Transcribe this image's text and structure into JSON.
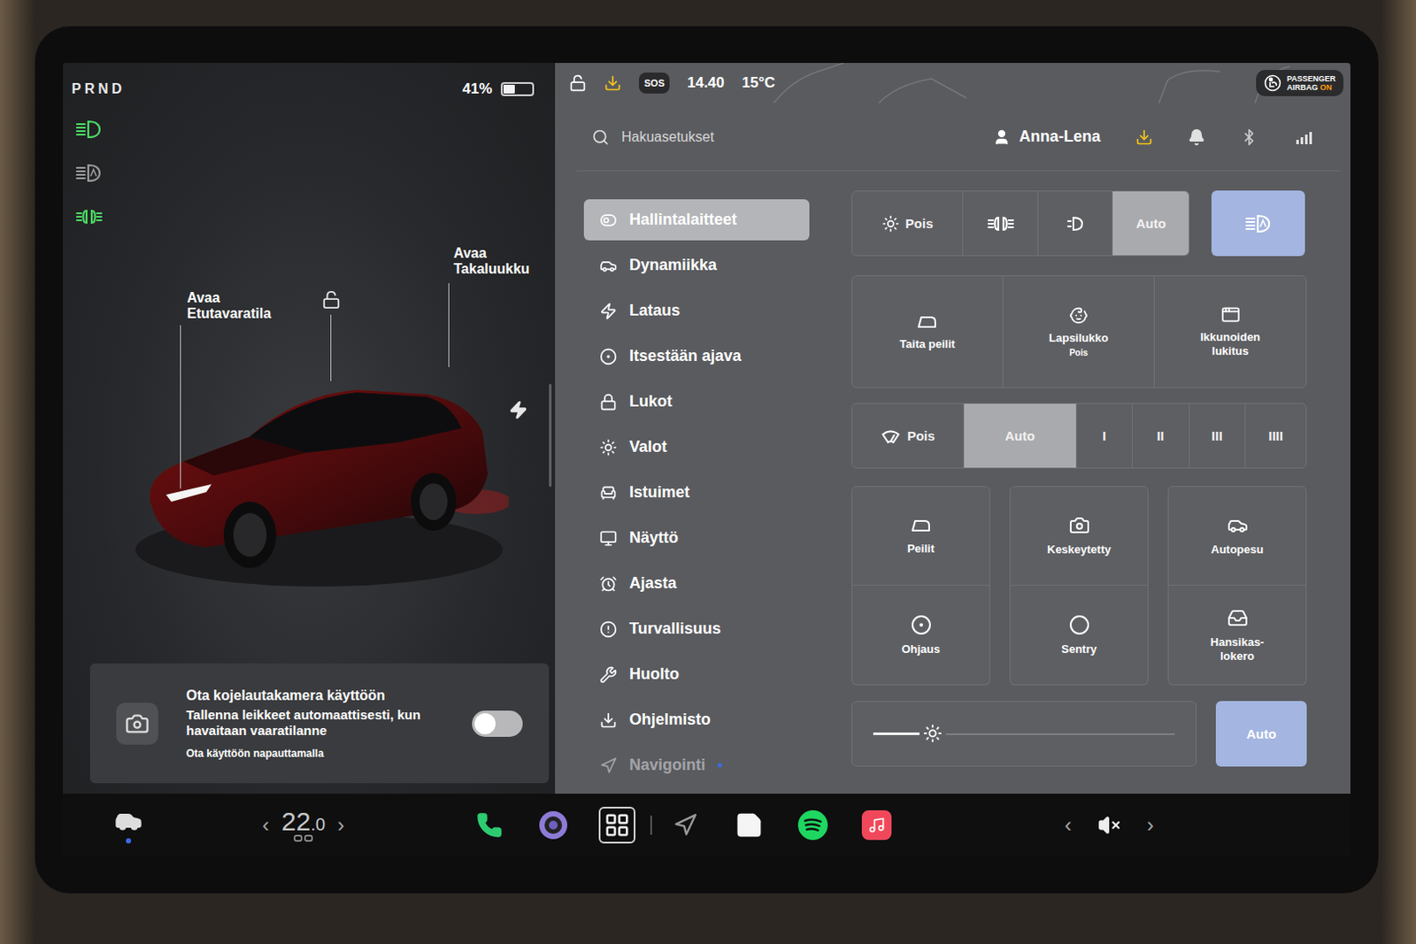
{
  "left_panel": {
    "gear": "PRND",
    "battery": {
      "text": "41%",
      "level": 0.41
    },
    "indicators": [
      {
        "on": true
      },
      {
        "on": false
      },
      {
        "on": true
      }
    ],
    "car_labels": [
      "Avaa\nEtutavaratila",
      "Avaa\nTakaluukku"
    ],
    "unlocked": true
  },
  "dashcam_card": {
    "title": "Ota kojelautakamera käyttöön",
    "description": "Tallenna leikkeet automaattisesti, kun havaitaan vaaratilanne",
    "hint": "Ota käyttöön napauttamalla",
    "on": false
  },
  "status_bar": {
    "sos": "SOS",
    "time": "14.40",
    "temperature": "15°C",
    "airbag": {
      "line1": "PASSENGER",
      "line2": "AIRBAG",
      "state": "ON"
    }
  },
  "search": {
    "placeholder": "Hakuasetukset"
  },
  "profile": {
    "name": "Anna-Lena"
  },
  "menu": [
    {
      "label": "Hallintalaitteet",
      "selected": true,
      "disabled": false,
      "dot": false
    },
    {
      "label": "Dynamiikka",
      "selected": false,
      "disabled": false,
      "dot": false
    },
    {
      "label": "Lataus",
      "selected": false,
      "disabled": false,
      "dot": false
    },
    {
      "label": "Itsestään ajava",
      "selected": false,
      "disabled": false,
      "dot": false
    },
    {
      "label": "Lukot",
      "selected": false,
      "disabled": false,
      "dot": false
    },
    {
      "label": "Valot",
      "selected": false,
      "disabled": false,
      "dot": false
    },
    {
      "label": "Istuimet",
      "selected": false,
      "disabled": false,
      "dot": false
    },
    {
      "label": "Näyttö",
      "selected": false,
      "disabled": false,
      "dot": false
    },
    {
      "label": "Ajasta",
      "selected": false,
      "disabled": false,
      "dot": false
    },
    {
      "label": "Turvallisuus",
      "selected": false,
      "disabled": false,
      "dot": false
    },
    {
      "label": "Huolto",
      "selected": false,
      "disabled": false,
      "dot": false
    },
    {
      "label": "Ohjelmisto",
      "selected": false,
      "disabled": false,
      "dot": false
    },
    {
      "label": "Navigointi",
      "selected": false,
      "disabled": true,
      "dot": true
    }
  ],
  "light_modes": [
    {
      "label": "Pois",
      "selected": false
    },
    {
      "selected": false
    },
    {
      "selected": false
    },
    {
      "label": "Auto",
      "selected": true
    }
  ],
  "auto_high_beam": {
    "on": true
  },
  "quick_controls": [
    {
      "label": "Taita peilit"
    },
    {
      "label": "Lapsilukko",
      "sub": "Pois"
    },
    {
      "label": "Ikkunoiden\nlukitus"
    }
  ],
  "wiper_modes": [
    {
      "label": "Pois",
      "selected": false
    },
    {
      "label": "Auto",
      "selected": true
    },
    {
      "label": "I",
      "selected": false
    },
    {
      "label": "II",
      "selected": false
    },
    {
      "label": "III",
      "selected": false
    },
    {
      "label": "IIII",
      "selected": false
    }
  ],
  "tiles": [
    {
      "label": "Peilit"
    },
    {
      "label": "Keskeytetty"
    },
    {
      "label": "Autopesu"
    },
    {
      "label": "Ohjaus"
    },
    {
      "label": "Sentry"
    },
    {
      "label": "Hansikas-\nlokero"
    }
  ],
  "brightness": {
    "level": 0.16,
    "auto": {
      "label": "Auto",
      "on": true
    }
  },
  "dock": {
    "temperature": {
      "prev": "‹",
      "value": "22",
      "decimal": ".0",
      "next": "›"
    },
    "apps": [
      {
        "selected": false
      },
      {
        "selected": false
      },
      {
        "selected": true
      },
      {
        "selected": false
      },
      {
        "selected": false
      },
      {
        "selected": false
      },
      {
        "selected": false
      }
    ],
    "volume": {
      "prev": "‹",
      "muted": true,
      "next": "›"
    }
  }
}
